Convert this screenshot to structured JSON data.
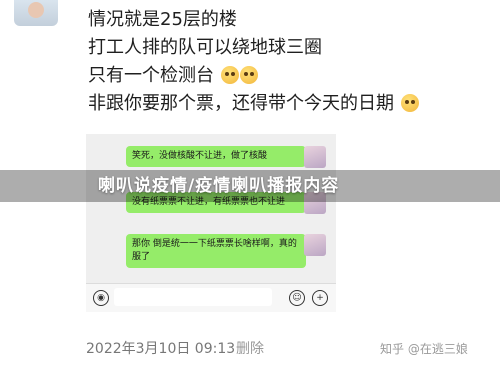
{
  "post": {
    "lines": [
      "情况就是25层的楼",
      "打工人排的队可以绕地球三圈",
      "只有一个检测台",
      "非跟你要那个票，还得带个今天的日期"
    ]
  },
  "chat": {
    "bubbles": [
      "笑死，没做核酸不让进，做了核酸",
      "没有纸票票不让进，有纸票票也不让进",
      "那你 倒是统一一下纸票票长啥样啊，真的服了"
    ]
  },
  "banner": {
    "title": "喇叭说疫情/疫情喇叭播报内容"
  },
  "footer": {
    "date": "2022年3月10日 09:13",
    "edit_label": "删除",
    "watermark": "知乎 @在逃三娘"
  },
  "colors": {
    "bubble": "#95ec69",
    "banner_overlay": "rgba(0,0,0,0.32)"
  },
  "icons": {
    "voice": "voice-icon",
    "emoji": "emoji-face-icon",
    "plus": "plus-icon"
  }
}
